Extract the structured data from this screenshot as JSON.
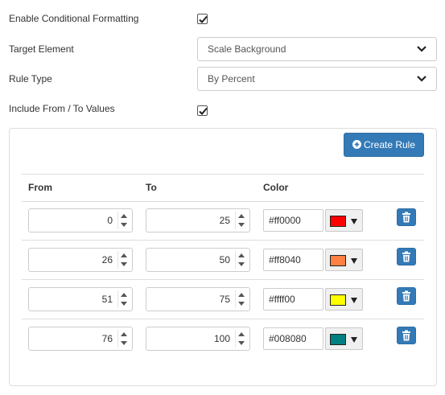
{
  "settings": {
    "enable_label": "Enable Conditional Formatting",
    "enable_checked": true,
    "target_label": "Target Element",
    "target_value": "Scale Background",
    "rule_type_label": "Rule Type",
    "rule_type_value": "By Percent",
    "include_label": "Include From / To Values",
    "include_checked": true
  },
  "panel": {
    "create_button": "Create Rule",
    "headers": {
      "from": "From",
      "to": "To",
      "color": "Color"
    },
    "rules": [
      {
        "from": "0",
        "to": "25",
        "color": "#ff0000"
      },
      {
        "from": "26",
        "to": "50",
        "color": "#ff8040"
      },
      {
        "from": "51",
        "to": "75",
        "color": "#ffff00"
      },
      {
        "from": "76",
        "to": "100",
        "color": "#008080"
      }
    ]
  }
}
